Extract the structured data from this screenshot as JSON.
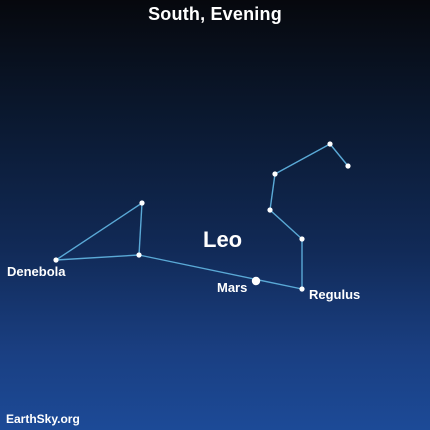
{
  "header": {
    "title": "South, Evening"
  },
  "labels": {
    "constellation": "Leo",
    "denebola": "Denebola",
    "mars": "Mars",
    "regulus": "Regulus"
  },
  "footer": {
    "credit": "EarthSky.org"
  },
  "colors": {
    "line": "#5aa9d6",
    "star": "#ffffff"
  }
}
